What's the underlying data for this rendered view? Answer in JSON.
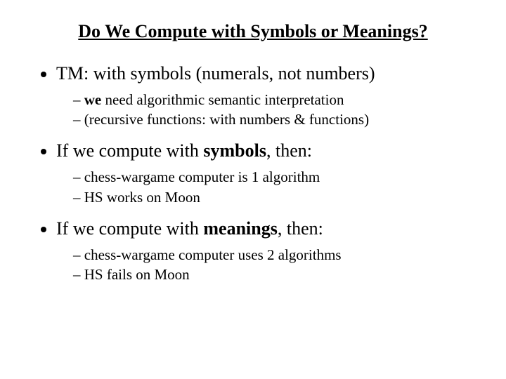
{
  "title": "Do We Compute with Symbols or Meanings?",
  "b1": {
    "pre": "TM:  with symbols (numerals, not numbers)",
    "s1_we": "we",
    "s1_rest": " need algorithmic semantic interpretation",
    "s2": "(recursive functions:  with numbers & functions)"
  },
  "b2": {
    "pre": "If we compute with ",
    "bold": "symbols",
    "post": ", then:",
    "s1": "chess-wargame computer is 1 algorithm",
    "s2": "HS works on Moon"
  },
  "b3": {
    "pre": "If we compute with ",
    "bold": "meanings",
    "post": ", then:",
    "s1": "chess-wargame computer uses 2 algorithms",
    "s2": "HS fails on Moon"
  }
}
